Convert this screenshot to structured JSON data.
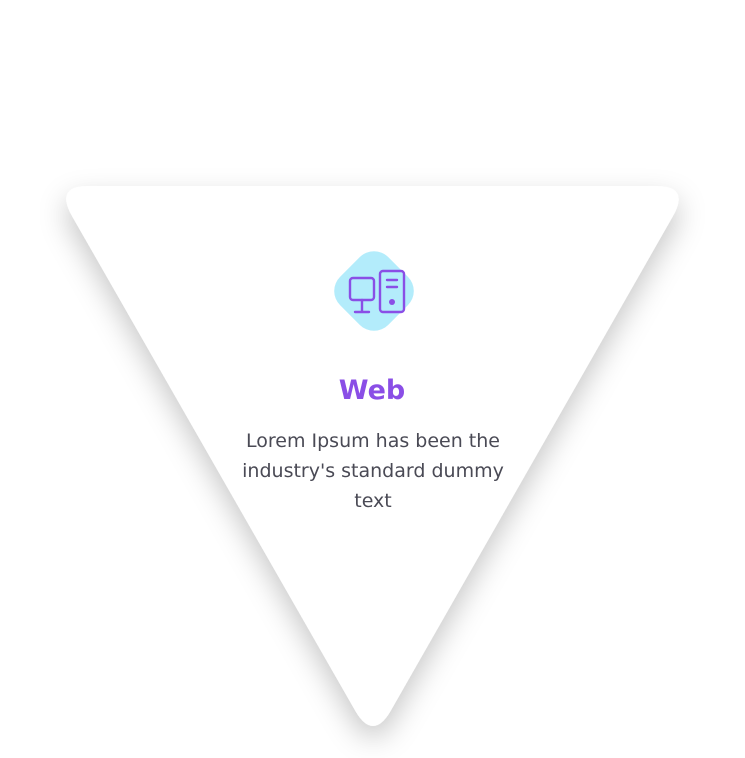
{
  "card": {
    "title": "Web",
    "description": "Lorem Ipsum has been the industry's standard dummy text",
    "icon": "computer-desktop-icon"
  },
  "colors": {
    "background": "#ffffff",
    "card": "#ffffff",
    "icon_bg": "#b3ecfb",
    "icon_stroke": "#8a4ee6",
    "title": "#8a4ee6",
    "text": "#4a4a55"
  }
}
